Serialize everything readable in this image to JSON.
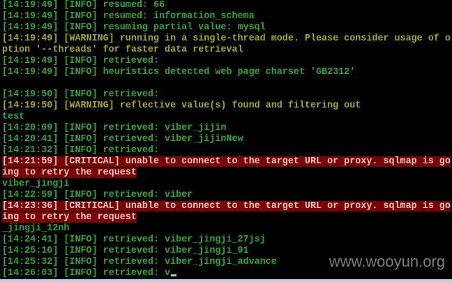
{
  "terminal": {
    "lines": [
      {
        "type": "info",
        "text": "[14:19:49] [INFO] resumed: 66"
      },
      {
        "type": "info",
        "text": "[14:19:49] [INFO] resumed: information_schema"
      },
      {
        "type": "info",
        "text": "[14:19:49] [INFO] resuming partial value: mysql"
      },
      {
        "type": "warning",
        "text": "[14:19:49] [WARNING] running in a single-thread mode. Please consider usage of o"
      },
      {
        "type": "warning",
        "text": "ption '--threads' for faster data retrieval"
      },
      {
        "type": "info",
        "text": "[14:19:49] [INFO] retrieved:"
      },
      {
        "type": "info",
        "text": "[14:19:49] [INFO] heuristics detected web page charset 'GB2312'"
      },
      {
        "type": "plain",
        "text": ""
      },
      {
        "type": "info",
        "text": "[14:19:50] [INFO] retrieved:"
      },
      {
        "type": "warning",
        "text": "[14:19:50] [WARNING] reflective value(s) found and filtering out"
      },
      {
        "type": "plain",
        "text": "test"
      },
      {
        "type": "info",
        "text": "[14:20:09] [INFO] retrieved: viber_jijin"
      },
      {
        "type": "info",
        "text": "[14:20:41] [INFO] retrieved: viber_jijinNew"
      },
      {
        "type": "info",
        "text": "[14:21:32] [INFO] retrieved:"
      },
      {
        "type": "critical",
        "text": "[14:21:59] [CRITICAL] unable to connect to the target URL or proxy. sqlmap is go"
      },
      {
        "type": "critical",
        "text": "ing to retry the request"
      },
      {
        "type": "plain",
        "text": "viber_jingji"
      },
      {
        "type": "info",
        "text": "[14:22:59] [INFO] retrieved: viber"
      },
      {
        "type": "critical",
        "text": "[14:23:36] [CRITICAL] unable to connect to the target URL or proxy. sqlmap is go"
      },
      {
        "type": "critical",
        "text": "ing to retry the request"
      },
      {
        "type": "plain",
        "text": "_jingji_12nh"
      },
      {
        "type": "info",
        "text": "[14:24:41] [INFO] retrieved: viber_jingji_27jsj"
      },
      {
        "type": "info",
        "text": "[14:25:10] [INFO] retrieved: viber_jingji_91"
      },
      {
        "type": "info",
        "text": "[14:25:32] [INFO] retrieved: viber_jingji_advance"
      },
      {
        "type": "info",
        "text": "[14:26:03] [INFO] retrieved: v",
        "cursor": true
      }
    ]
  },
  "watermark": "www.wooyun.org"
}
